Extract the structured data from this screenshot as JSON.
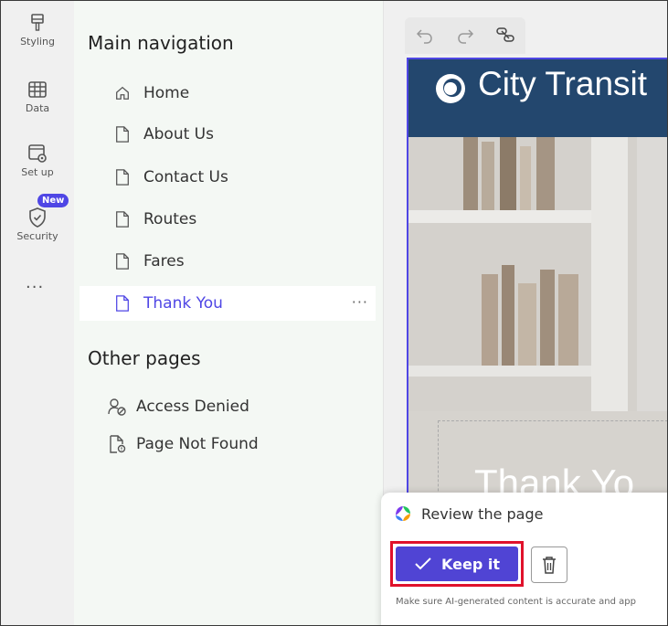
{
  "rail": {
    "items": [
      {
        "label": "Styling",
        "icon": "brush-icon"
      },
      {
        "label": "Data",
        "icon": "table-icon"
      },
      {
        "label": "Set up",
        "icon": "setup-icon"
      },
      {
        "label": "Security",
        "icon": "shield-icon"
      }
    ],
    "new_badge": "New",
    "more": "···"
  },
  "nav": {
    "main_title": "Main navigation",
    "items": [
      {
        "label": "Home",
        "icon": "home-icon"
      },
      {
        "label": "About Us",
        "icon": "page-icon"
      },
      {
        "label": "Contact Us",
        "icon": "page-icon"
      },
      {
        "label": "Routes",
        "icon": "page-icon"
      },
      {
        "label": "Fares",
        "icon": "page-icon"
      },
      {
        "label": "Thank You",
        "icon": "page-icon",
        "selected": true
      }
    ],
    "selected_more": "···",
    "other_title": "Other pages",
    "other_items": [
      {
        "label": "Access Denied",
        "icon": "person-blocked-icon"
      },
      {
        "label": "Page Not Found",
        "icon": "page-search-icon"
      }
    ]
  },
  "preview": {
    "site_title": "City Transit",
    "hero_text": "Thank Yo"
  },
  "popup": {
    "title": "Review the page",
    "keep_label": "Keep it",
    "disclaimer": "Make sure AI-generated content is accurate and app"
  },
  "colors": {
    "accent": "#4f46e5",
    "header_bg": "#23476e",
    "highlight": "#e0112b"
  }
}
